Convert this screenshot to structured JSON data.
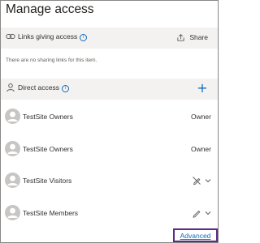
{
  "panel": {
    "title": "Manage access"
  },
  "links_section": {
    "label": "Links giving access",
    "info_icon": "i",
    "icon": "link-icon",
    "share_label": "Share",
    "share_icon": "share-icon",
    "empty_message": "There are no sharing links for this item."
  },
  "direct_section": {
    "label": "Direct access",
    "info_icon": "i",
    "icon": "person-icon",
    "add_symbol": "+",
    "add_icon": "plus-icon"
  },
  "members": [
    {
      "name": "TestSite Owners",
      "role": "Owner",
      "avatar": "user-avatar-icon"
    },
    {
      "name": "TestSite Owners",
      "role": "Owner",
      "avatar": "user-avatar-icon"
    },
    {
      "name": "TestSite Visitors",
      "role_icon": "no-edit-icon",
      "dropdown_icon": "chevron-down-icon"
    },
    {
      "name": "TestSite Members",
      "role_icon": "edit-pencil-icon",
      "dropdown_icon": "chevron-down-icon"
    }
  ],
  "footer": {
    "advanced_label": "Advanced"
  },
  "colors": {
    "accent": "#0f6cbd",
    "header_background": "#f3f2f1",
    "highlight_border": "#5b2c86",
    "avatar": "#c8c6c4"
  }
}
